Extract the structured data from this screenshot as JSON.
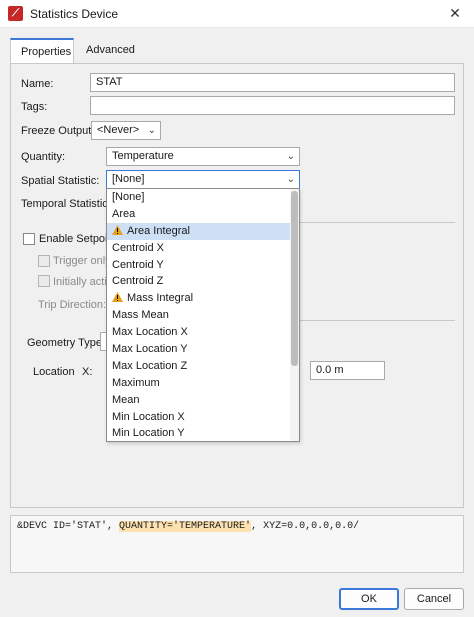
{
  "window": {
    "title": "Statistics Device",
    "close_glyph": "✕"
  },
  "tabs": [
    {
      "label": "Properties",
      "active": true
    },
    {
      "label": "Advanced",
      "active": false
    }
  ],
  "form": {
    "name_label": "Name:",
    "name_value": "STAT",
    "tags_label": "Tags:",
    "tags_value": "",
    "freeze_label": "Freeze Output:",
    "freeze_value": "<Never>",
    "quantity_label": "Quantity:",
    "quantity_value": "Temperature",
    "spatial_label": "Spatial Statistic:",
    "spatial_value": "[None]",
    "temporal_label": "Temporal Statistic:",
    "setpoint_label": "Enable Setpoint",
    "trigger_label": "Trigger only",
    "initially_label": "Initially activ",
    "trip_label": "Trip Direction:",
    "geometry_label": "Geometry Type:",
    "location_label": "Location",
    "x_label": "X:",
    "z_value": "0.0 m"
  },
  "dropdown": {
    "items": [
      {
        "label": "[None]",
        "warn": false,
        "selected": false
      },
      {
        "label": "Area",
        "warn": false,
        "selected": false
      },
      {
        "label": "Area Integral",
        "warn": true,
        "selected": true
      },
      {
        "label": "Centroid X",
        "warn": false,
        "selected": false
      },
      {
        "label": "Centroid Y",
        "warn": false,
        "selected": false
      },
      {
        "label": "Centroid Z",
        "warn": false,
        "selected": false
      },
      {
        "label": "Mass Integral",
        "warn": true,
        "selected": false
      },
      {
        "label": "Mass Mean",
        "warn": false,
        "selected": false
      },
      {
        "label": "Max Location X",
        "warn": false,
        "selected": false
      },
      {
        "label": "Max Location Y",
        "warn": false,
        "selected": false
      },
      {
        "label": "Max Location Z",
        "warn": false,
        "selected": false
      },
      {
        "label": "Maximum",
        "warn": false,
        "selected": false
      },
      {
        "label": "Mean",
        "warn": false,
        "selected": false
      },
      {
        "label": "Min Location X",
        "warn": false,
        "selected": false
      },
      {
        "label": "Min Location Y",
        "warn": false,
        "selected": false
      }
    ],
    "warn_color": "#e6a01a",
    "selected_color": "#cde0f5"
  },
  "fds": {
    "prefix": "&DEVC ID='STAT', ",
    "highlight": "QUANTITY='TEMPERATURE'",
    "suffix": ", XYZ=0.0,0.0,0.0/"
  },
  "buttons": {
    "ok": "OK",
    "cancel": "Cancel"
  },
  "colors": {
    "accent": "#3c78d8",
    "brand": "#c62828",
    "highlight": "#fde2b0"
  }
}
